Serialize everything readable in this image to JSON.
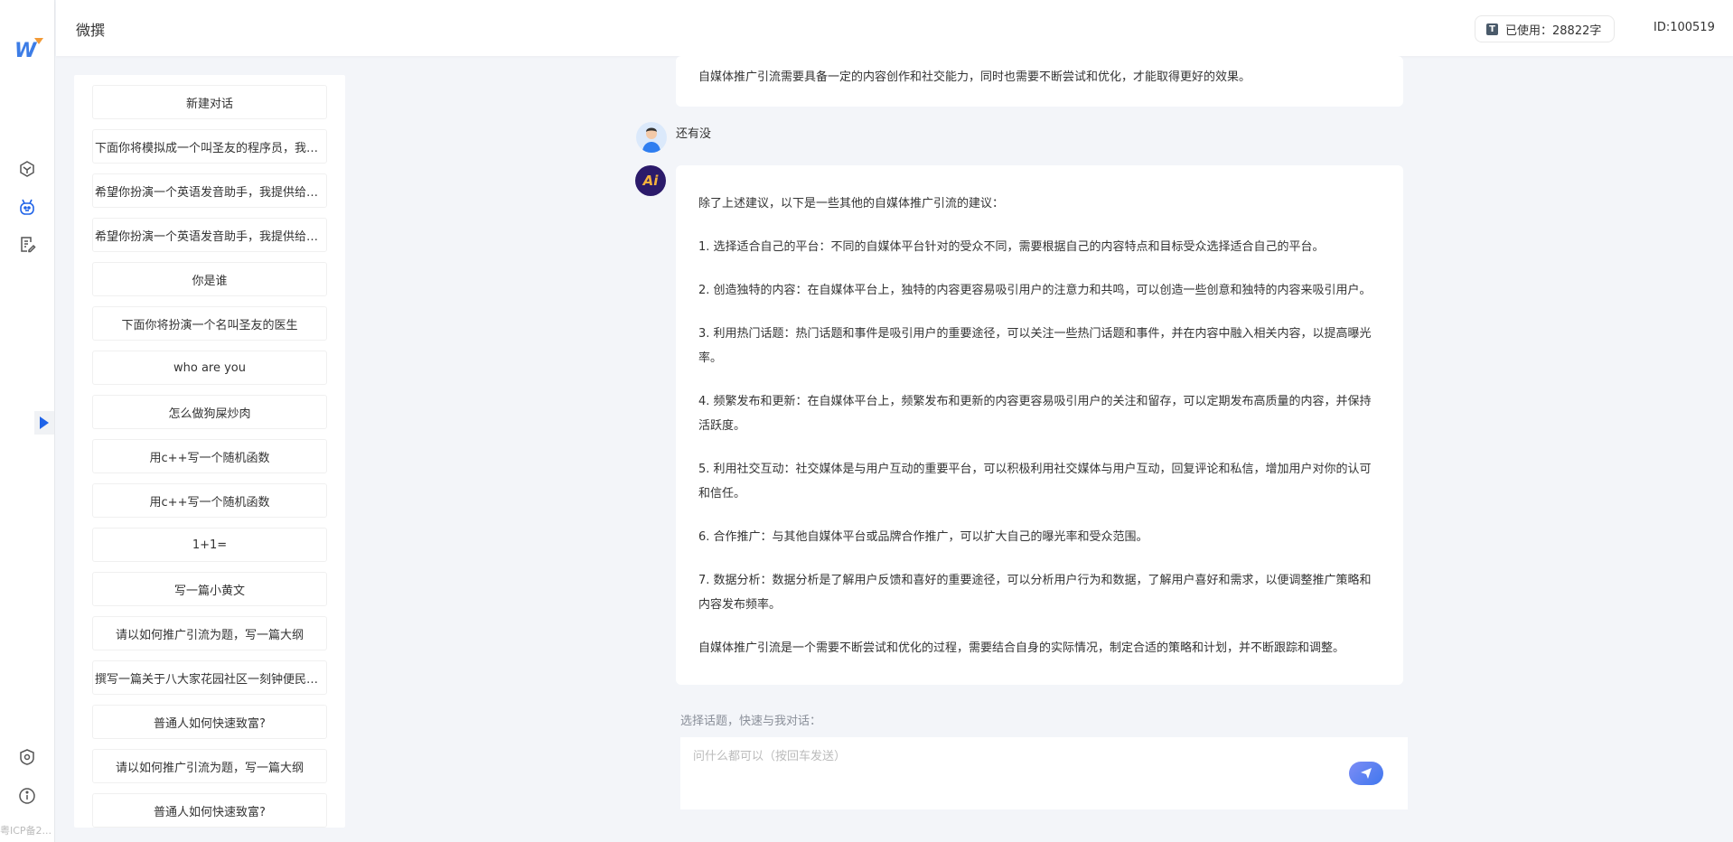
{
  "app": {
    "title": "微撰",
    "logo": "W",
    "icp": "粤ICP备2..."
  },
  "header": {
    "usage_label": "已使用：28822字",
    "usage_icon": "T",
    "user_id": "ID:100519"
  },
  "history": [
    "新建对话",
    "下面你将模拟成一个叫圣友的程序员，我说...",
    "希望你扮演一个英语发音助手，我提供给你...",
    "希望你扮演一个英语发音助手，我提供给你...",
    "你是谁",
    "下面你将扮演一个名叫圣友的医生",
    "who are you",
    "怎么做狗屎炒肉",
    "用c++写一个随机函数",
    "用c++写一个随机函数",
    "1+1=",
    "写一篇小黄文",
    "请以如何推广引流为题，写一篇大纲",
    "撰写一篇关于八大家花园社区一刻钟便民生...",
    "普通人如何快速致富?",
    "请以如何推广引流为题，写一篇大纲",
    "普通人如何快速致富?"
  ],
  "chat": {
    "previous_tail": "自媒体推广引流需要具备一定的内容创作和社交能力，同时也需要不断尝试和优化，才能取得更好的效果。",
    "user_message": "还有没",
    "ai_avatar": "Ai",
    "answer": [
      "除了上述建议，以下是一些其他的自媒体推广引流的建议：",
      "1. 选择适合自己的平台：不同的自媒体平台针对的受众不同，需要根据自己的内容特点和目标受众选择适合自己的平台。",
      "2. 创造独特的内容：在自媒体平台上，独特的内容更容易吸引用户的注意力和共鸣，可以创造一些创意和独特的内容来吸引用户。",
      "3. 利用热门话题：热门话题和事件是吸引用户的重要途径，可以关注一些热门话题和事件，并在内容中融入相关内容，以提高曝光率。",
      "4. 频繁发布和更新：在自媒体平台上，频繁发布和更新的内容更容易吸引用户的关注和留存，可以定期发布高质量的内容，并保持活跃度。",
      "5. 利用社交互动：社交媒体是与用户互动的重要平台，可以积极利用社交媒体与用户互动，回复评论和私信，增加用户对你的认可和信任。",
      "6. 合作推广：与其他自媒体平台或品牌合作推广，可以扩大自己的曝光率和受众范围。",
      "7. 数据分析：数据分析是了解用户反馈和喜好的重要途径，可以分析用户行为和数据，了解用户喜好和需求，以便调整推广策略和内容发布频率。",
      "自媒体推广引流是一个需要不断尝试和优化的过程，需要结合自身的实际情况，制定合适的策略和计划，并不断跟踪和调整。"
    ]
  },
  "composer": {
    "prompt_label": "选择话题，快速与我对话：",
    "placeholder": "问什么都可以（按回车发送）",
    "value": ""
  },
  "colors": {
    "accent": "#1f63e8",
    "background": "#f3f5f9"
  }
}
